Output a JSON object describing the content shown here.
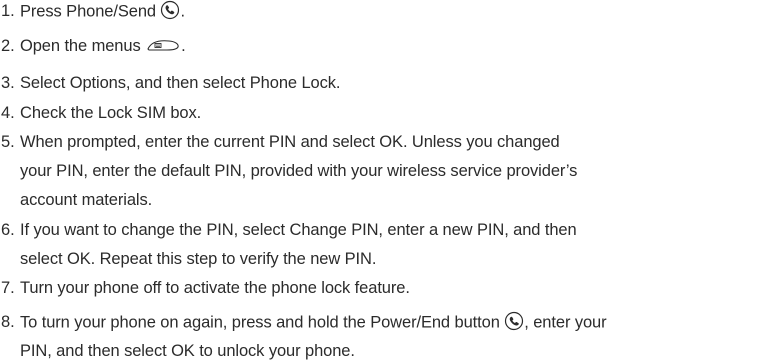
{
  "steps": [
    {
      "num": "1.",
      "lines": [
        {
          "pre": "Press Phone/Send",
          "icon": "phone-send-icon",
          "post": "."
        }
      ]
    },
    {
      "num": "2.",
      "lines": [
        {
          "pre": "Open the menus",
          "icon": "menu-icon",
          "post": "."
        }
      ]
    },
    {
      "num": "3.",
      "lines": [
        {
          "pre": "Select Options, and then select Phone Lock."
        }
      ]
    },
    {
      "num": "4.",
      "lines": [
        {
          "pre": "Check the Lock SIM box."
        }
      ]
    },
    {
      "num": "5.",
      "lines": [
        {
          "pre": "When prompted, enter the current PIN and select OK. Unless you changed"
        },
        {
          "pre": "your  PIN, enter the default PIN, provided with your wireless service provider’s"
        },
        {
          "pre": "account  materials."
        }
      ]
    },
    {
      "num": "6.",
      "lines": [
        {
          "pre": "If you want to change the PIN, select Change PIN, enter a new PIN, and then"
        },
        {
          "pre": "select OK. Repeat this step to verify the new PIN."
        }
      ]
    },
    {
      "num": "7.",
      "lines": [
        {
          "pre": "Turn your phone off to activate the phone lock feature."
        }
      ]
    },
    {
      "num": "8.",
      "lines": [
        {
          "pre": "To turn your phone on again, press and hold the Power/End button",
          "icon": "power-end-icon",
          "post": ", enter your"
        },
        {
          "pre": "PIN, and then select OK to unlock your phone."
        }
      ]
    }
  ]
}
